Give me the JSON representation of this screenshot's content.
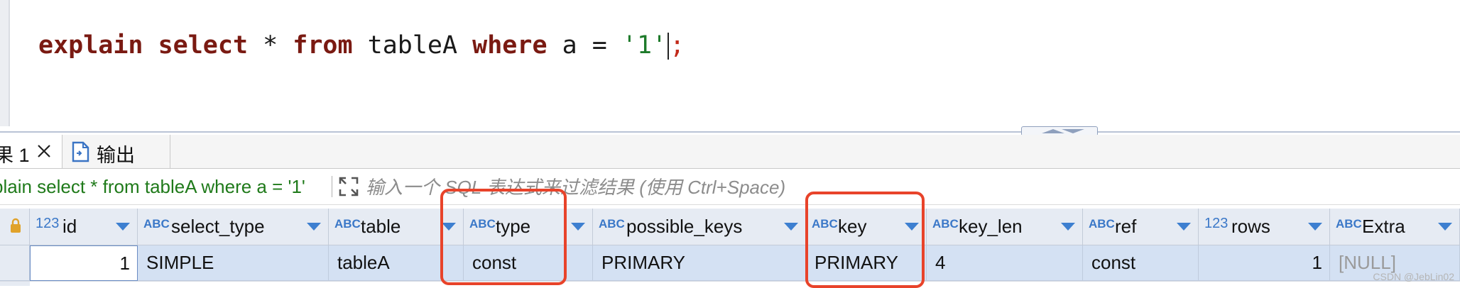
{
  "editor": {
    "code": {
      "kw_explain": "explain",
      "kw_select": "select",
      "star": "*",
      "kw_from": "from",
      "table": "tableA",
      "kw_where": "where",
      "column": "a",
      "op": "=",
      "value": "'1'",
      "terminator": ";"
    }
  },
  "tabs": {
    "results_label": "果 1",
    "output_label": "输出"
  },
  "filter": {
    "query_text": "plain select * from tableA where a = '1'",
    "placeholder": "输入一个 SQL 表达式来过滤结果 (使用 Ctrl+Space)"
  },
  "grid": {
    "columns": [
      {
        "name": "id",
        "type_icon": "123"
      },
      {
        "name": "select_type",
        "type_icon": "ABC"
      },
      {
        "name": "table",
        "type_icon": "ABC"
      },
      {
        "name": "type",
        "type_icon": "ABC"
      },
      {
        "name": "possible_keys",
        "type_icon": "ABC"
      },
      {
        "name": "key",
        "type_icon": "ABC"
      },
      {
        "name": "key_len",
        "type_icon": "ABC"
      },
      {
        "name": "ref",
        "type_icon": "ABC"
      },
      {
        "name": "rows",
        "type_icon": "123"
      },
      {
        "name": "Extra",
        "type_icon": "ABC"
      }
    ],
    "rows": [
      [
        "1",
        "SIMPLE",
        "tableA",
        "const",
        "PRIMARY",
        "PRIMARY",
        "4",
        "const",
        "1",
        "[NULL]"
      ]
    ]
  },
  "colors": {
    "keyword": "#7a1a12",
    "string": "#1d7a2a",
    "highlight_box": "#e8432a",
    "header_bg": "#e6ebf3",
    "selected_row": "#d4e1f3",
    "type_icon": "#3b78c8"
  },
  "watermark": "CSDN @JebLin02"
}
